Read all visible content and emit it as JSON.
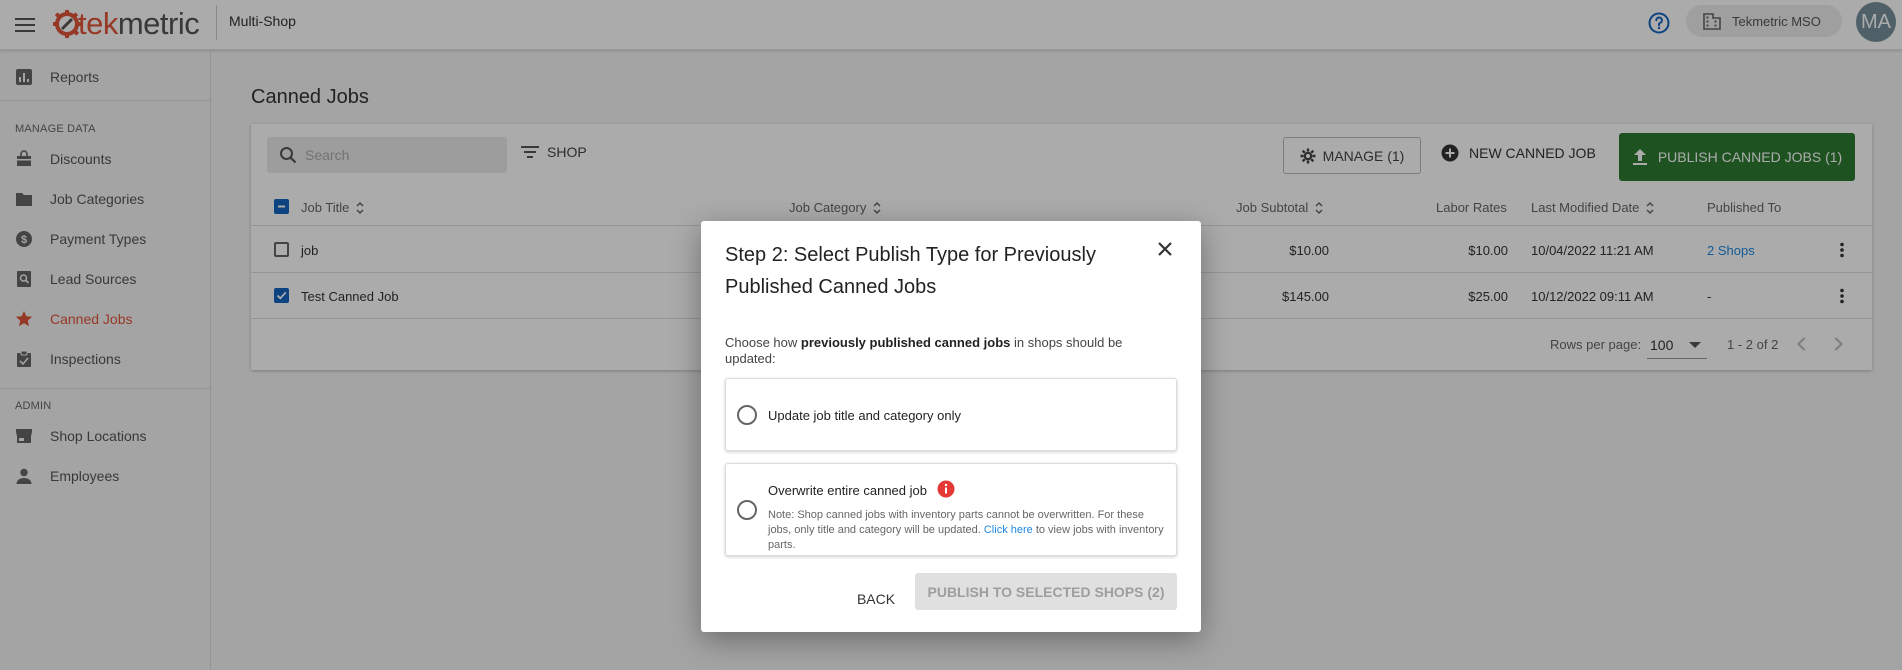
{
  "header": {
    "logo_part1": "tek",
    "logo_part2": "metric",
    "app_name": "Multi-Shop",
    "org_name": "Tekmetric MSO",
    "avatar_initials": "MA"
  },
  "sidebar": {
    "reports": "Reports",
    "manage_section": "MANAGE DATA",
    "manage_items": [
      {
        "label": "Discounts",
        "icon": "discount-icon"
      },
      {
        "label": "Job Categories",
        "icon": "folder-icon"
      },
      {
        "label": "Payment Types",
        "icon": "dollar-circle-icon"
      },
      {
        "label": "Lead Sources",
        "icon": "magnify-doc-icon"
      },
      {
        "label": "Canned Jobs",
        "icon": "star-icon",
        "active": true
      },
      {
        "label": "Inspections",
        "icon": "clipboard-icon"
      }
    ],
    "admin_section": "ADMIN",
    "admin_items": [
      {
        "label": "Shop Locations",
        "icon": "store-icon"
      },
      {
        "label": "Employees",
        "icon": "person-icon"
      }
    ]
  },
  "page": {
    "title": "Canned Jobs",
    "search_placeholder": "Search",
    "shop_filter": "SHOP",
    "manage_button": "MANAGE (1)",
    "new_button": "NEW CANNED JOB",
    "publish_button": "PUBLISH CANNED JOBS (1)"
  },
  "table": {
    "headers": {
      "job_title": "Job Title",
      "job_category": "Job Category",
      "job_subtotal": "Job Subtotal",
      "labor_rates": "Labor Rates",
      "last_modified": "Last Modified Date",
      "published_to": "Published To"
    },
    "rows": [
      {
        "title": "job",
        "subtotal": "$10.00",
        "labor": "$10.00",
        "modified": "10/04/2022 11:21 AM",
        "published": "2 Shops",
        "checked": false
      },
      {
        "title": "Test Canned Job",
        "subtotal": "$145.00",
        "labor": "$25.00",
        "modified": "10/12/2022 09:11 AM",
        "published": "-",
        "checked": true
      }
    ],
    "footer": {
      "rows_per_page_label": "Rows per page:",
      "rows_per_page": "100",
      "range": "1 - 2 of 2"
    }
  },
  "dialog": {
    "title": "Step 2: Select Publish Type for Previously Published Canned Jobs",
    "desc_before": "Choose how ",
    "desc_bold": "previously published canned jobs",
    "desc_after": " in shops should be updated:",
    "option1_label": "Update job title and category only",
    "option2_label": "Overwrite entire canned job",
    "option2_note_before": "Note: Shop canned jobs with inventory parts cannot be overwritten. For these jobs, only title and category will be updated. ",
    "option2_note_link": "Click here",
    "option2_note_after": " to view jobs with inventory parts.",
    "back_button": "BACK",
    "publish_button": "PUBLISH TO SELECTED SHOPS (2)"
  },
  "colors": {
    "brand": "#e0553b",
    "publish_green": "#2e7d32",
    "link_blue": "#1e88e5",
    "checkbox_blue": "#1565c0",
    "info_red": "#e53935"
  }
}
